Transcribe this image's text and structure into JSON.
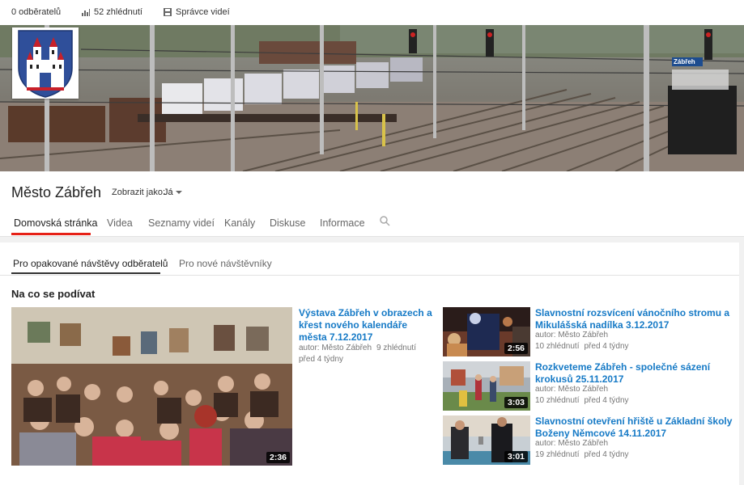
{
  "topbar": {
    "subscribers": "0 odběratelů",
    "views": "52 zhlédnutí",
    "manager": "Správce videí",
    "icons": [
      "bars-chart-icon",
      "film-icon"
    ]
  },
  "channel": {
    "name": "Město Zábřeh",
    "view_as_label": "Zobrazit jako:",
    "view_as_value": "Já"
  },
  "banner": {
    "station_sign": "Zábřeh"
  },
  "tabs": [
    "Domovská stránka",
    "Videa",
    "Seznamy videí",
    "Kanály",
    "Diskuse",
    "Informace"
  ],
  "subtabs": [
    "Pro opakované návštěvy odběratelů",
    "Pro nové návštěvníky"
  ],
  "section_title": "Na co se podívat",
  "featured": {
    "title": "Výstava Zábřeh v obrazech a křest nového kalendáře města 7.12.2017",
    "author": "autor: Město Zábřeh",
    "views": "9 zhlédnutí",
    "age": "před 4 týdny",
    "duration": "2:36"
  },
  "videos": [
    {
      "title": "Slavnostní rozsvícení vánočního stromu a Mikulášská nadílka 3.12.2017",
      "author": "autor: Město Zábřeh",
      "views": "10 zhlédnutí",
      "age": "před 4 týdny",
      "duration": "2:56"
    },
    {
      "title": "Rozkveteme Zábřeh - společné sázení krokusů 25.11.2017",
      "author": "autor: Město Zábřeh",
      "views": "10 zhlédnutí",
      "age": "před 4 týdny",
      "duration": "3:03"
    },
    {
      "title": "Slavnostní otevření hřiště u Základní školy Boženy Němcové 14.11.2017",
      "author": "autor: Město Zábřeh",
      "views": "19 zhlédnutí",
      "age": "před 4 týdny",
      "duration": "3:01"
    }
  ],
  "colors": {
    "link": "#167ac6",
    "tab_active_underline": "#e62117",
    "page_bg": "#f1f1f1"
  }
}
